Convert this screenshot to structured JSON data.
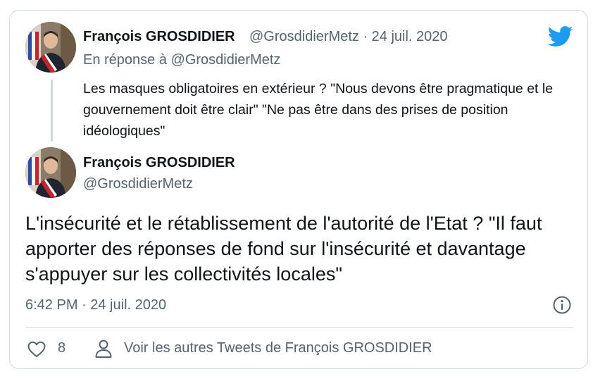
{
  "reply_tweet": {
    "author_name": "François GROSDIDIER",
    "handle_and_date": "@GrosdidierMetz · 24 juil. 2020",
    "reply_prefix": "En réponse à ",
    "reply_mention": "@GrosdidierMetz",
    "text": "Les masques obligatoires en extérieur ? \"Nous devons être pragmatique et le gouvernement doit être clair\" \"Ne pas être dans des prises de position idéologiques\""
  },
  "main_tweet": {
    "author_name": "François GROSDIDIER",
    "handle": "@GrosdidierMetz",
    "text": "L'insécurité et le rétablissement de l'autorité de l'Etat ? \"Il faut apporter des réponses de fond sur l'insécurité et davantage s'appuyer sur les collectivités locales\"",
    "timestamp": "6:42 PM · 24 juil. 2020"
  },
  "actions": {
    "like_count": "8",
    "more_tweets_label": "Voir les autres Tweets de François GROSDIDIER"
  },
  "icons": {
    "brand": "twitter-bird-icon",
    "info": "info-icon",
    "like": "heart-icon",
    "profile": "person-icon"
  },
  "colors": {
    "brand_blue": "#1d9bf0",
    "secondary_text": "#536471",
    "primary_text": "#0f1419",
    "border": "#cfd9de"
  }
}
